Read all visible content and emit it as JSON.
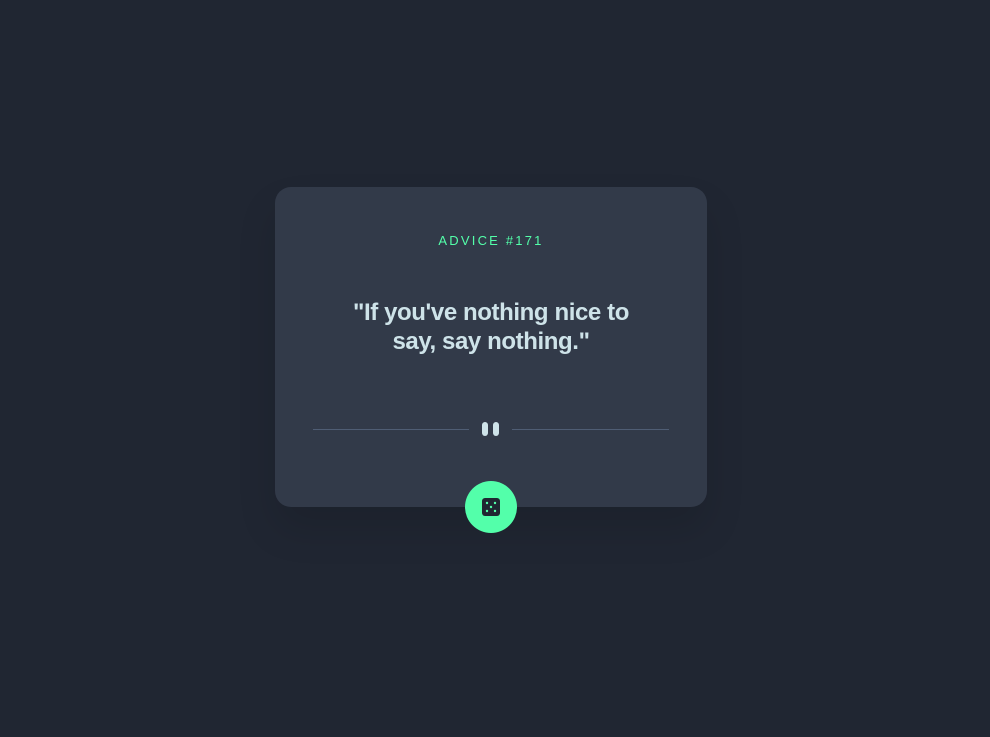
{
  "advice": {
    "label": "ADVICE #171",
    "quote": "\"If you've nothing nice to say, say nothing.\""
  },
  "icons": {
    "divider": "pause-icon",
    "button": "dice-icon"
  },
  "colors": {
    "background": "#202632",
    "card": "#323a49",
    "accent": "#53ffaa",
    "text": "#cee3e9",
    "divider": "#4f5d74"
  }
}
